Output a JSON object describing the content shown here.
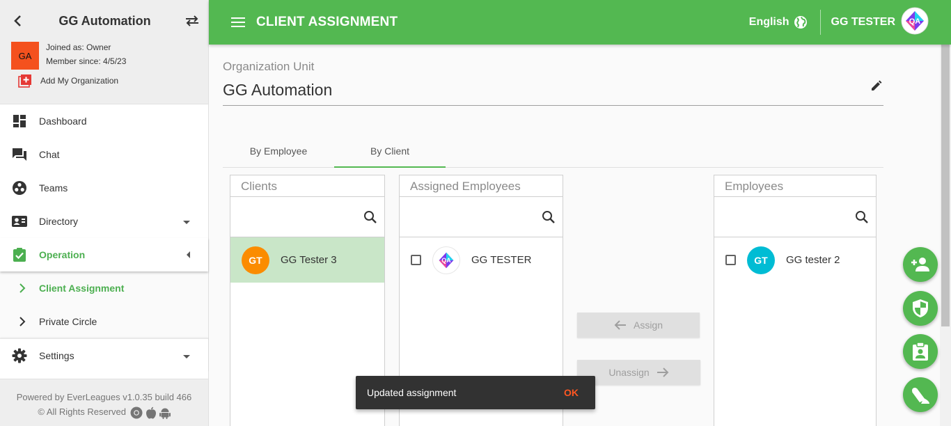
{
  "sidebar": {
    "org_name": "GG Automation",
    "avatar_initials": "GA",
    "joined_as": "Joined as: Owner",
    "member_since": "Member since: 4/5/23",
    "add_org_label": "Add My Organization",
    "items": [
      {
        "label": "Dashboard",
        "icon": "dashboard-icon"
      },
      {
        "label": "Chat",
        "icon": "chat-icon"
      },
      {
        "label": "Teams",
        "icon": "teams-icon"
      },
      {
        "label": "Directory",
        "icon": "directory-icon"
      },
      {
        "label": "Operation",
        "icon": "operation-icon"
      }
    ],
    "sub_items": [
      {
        "label": "Client Assignment"
      },
      {
        "label": "Private Circle"
      }
    ],
    "settings_label": "Settings",
    "footer_line1": "Powered by EverLeagues v1.0.35 build 466",
    "footer_line2": "© All Rights Reserved"
  },
  "topbar": {
    "title": "CLIENT ASSIGNMENT",
    "language": "English",
    "user_name": "GG TESTER",
    "brand_color": "#53b851"
  },
  "main": {
    "org_unit_label": "Organization Unit",
    "org_unit_value": "GG Automation",
    "tabs": [
      "By Employee",
      "By Client"
    ],
    "selected_tab": "By Client",
    "clients": {
      "header": "Clients",
      "search_placeholder": "",
      "rows": [
        {
          "initials": "GT",
          "name": "GG Tester 3",
          "color": "#fb8c00"
        }
      ]
    },
    "assigned": {
      "header": "Assigned Employees",
      "search_placeholder": "",
      "rows": [
        {
          "name": "GG TESTER"
        }
      ]
    },
    "employees": {
      "header": "Employees",
      "search_placeholder": "",
      "rows": [
        {
          "initials": "GT",
          "name": "GG tester 2",
          "color": "#00bcd4"
        }
      ]
    },
    "assign_label": "Assign",
    "unassign_label": "Unassign"
  },
  "fabs": [
    "add-person-icon",
    "shield-icon",
    "clipboard-person-icon",
    "horn-icon"
  ],
  "snackbar": {
    "message": "Updated assignment",
    "action": "OK"
  }
}
